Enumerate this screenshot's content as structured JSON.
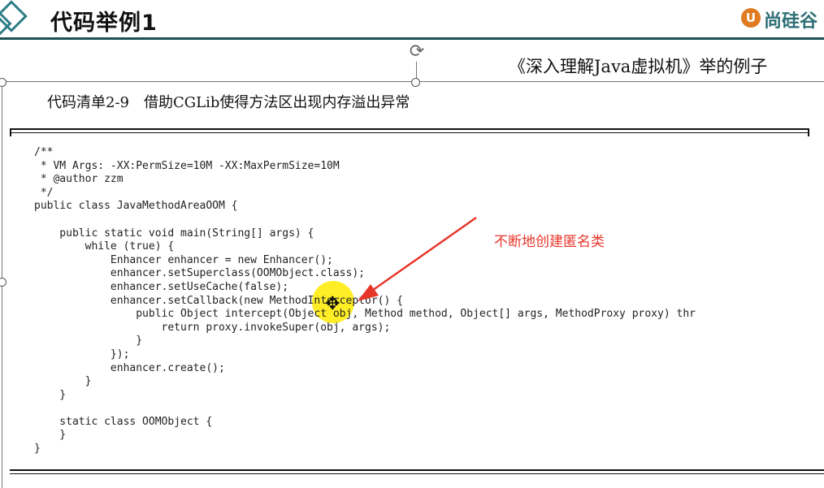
{
  "header": {
    "title": "代码举例1",
    "logo_mark": "U",
    "logo_text": "尚硅谷"
  },
  "slide": {
    "book_ref": "《深入理解Java虚拟机》举的例子",
    "listing_caption": "代码清单2-9　借助CGLib使得方法区出现内存溢出异常",
    "code_lines": [
      "/**",
      " * VM Args: -XX:PermSize=10M -XX:MaxPermSize=10M",
      " * @author zzm",
      " */",
      "public class JavaMethodAreaOOM {",
      "",
      "    public static void main(String[] args) {",
      "        while (true) {",
      "            Enhancer enhancer = new Enhancer();",
      "            enhancer.setSuperclass(OOMObject.class);",
      "            enhancer.setUseCache(false);",
      "            enhancer.setCallback(new MethodInterceptor() {",
      "                public Object intercept(Object obj, Method method, Object[] args, MethodProxy proxy) thr",
      "                    return proxy.invokeSuper(obj, args);",
      "                }",
      "            });",
      "            enhancer.create();",
      "        }",
      "    }",
      "",
      "    static class OOMObject {",
      "    }",
      "}"
    ],
    "annotation": "不断地创建匿名类",
    "annotation_color": "#e8352a"
  },
  "icons": {
    "rotate": "rotate-handle-icon",
    "cursor": "move-cursor-icon"
  }
}
